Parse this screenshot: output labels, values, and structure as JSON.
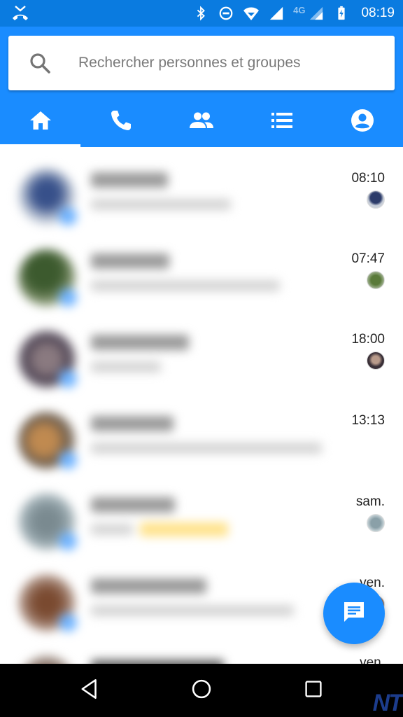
{
  "status_bar": {
    "network_label": "4G",
    "clock": "08:19",
    "left_icon": "missed-call-icon",
    "icons": [
      "bluetooth-icon",
      "do-not-disturb-icon",
      "wifi-icon",
      "signal-icon",
      "signal-icon",
      "battery-charging-icon"
    ]
  },
  "search": {
    "placeholder": "Rechercher personnes et groupes",
    "value": ""
  },
  "tabs": [
    {
      "icon": "home-icon",
      "active": true
    },
    {
      "icon": "phone-icon",
      "active": false
    },
    {
      "icon": "people-icon",
      "active": false
    },
    {
      "icon": "list-icon",
      "active": false
    },
    {
      "icon": "profile-icon",
      "active": false
    }
  ],
  "conversations": [
    {
      "time": "08:10",
      "has_seen_avatar": true
    },
    {
      "time": "07:47",
      "has_seen_avatar": true
    },
    {
      "time": "18:00",
      "has_seen_avatar": true
    },
    {
      "time": "13:13",
      "has_seen_avatar": false
    },
    {
      "time": "sam.",
      "has_seen_avatar": true
    },
    {
      "time": "ven.",
      "has_seen_avatar": true
    },
    {
      "time": "ven.",
      "has_seen_avatar": false
    }
  ],
  "fab": {
    "icon": "new-message-icon"
  },
  "nav_bar": {
    "buttons": [
      "back-icon",
      "home-circle-icon",
      "recents-icon"
    ]
  },
  "watermark": "NT",
  "colors": {
    "status_bar": "#0a7be0",
    "header": "#1a8cff",
    "accent": "#1a8cff"
  }
}
